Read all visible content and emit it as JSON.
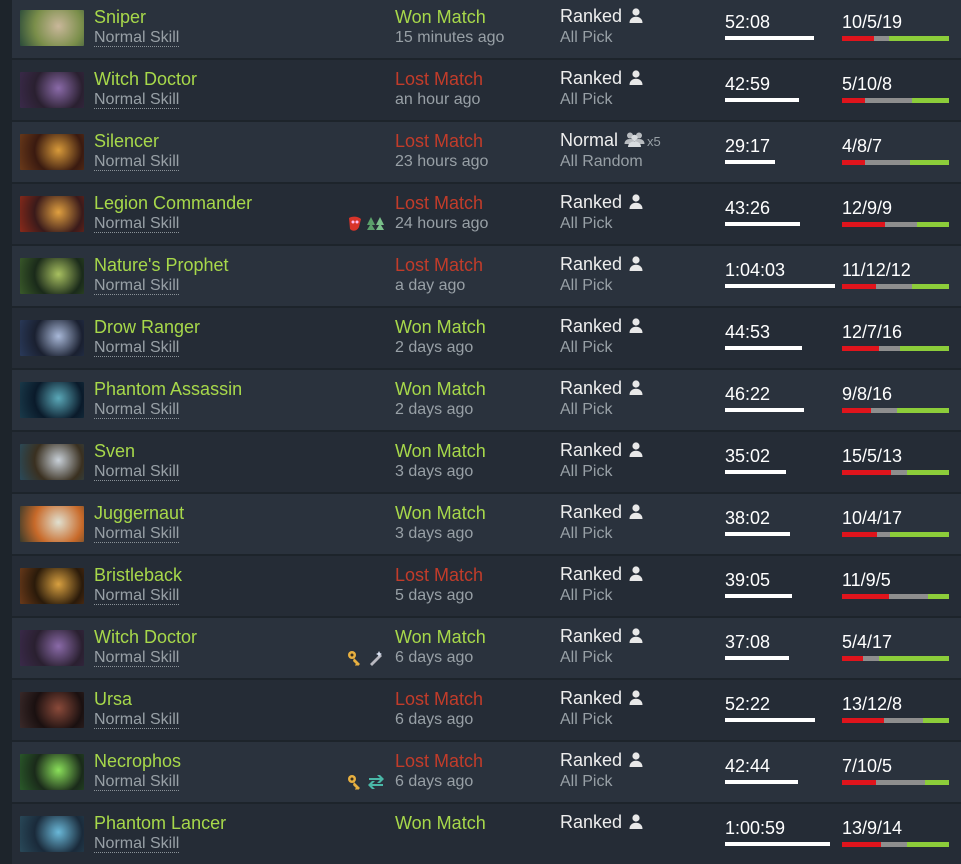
{
  "colors": {
    "won": "#a7d84a",
    "lost": "#c23c2a",
    "kills": "#e0141c",
    "deaths": "#8e8e8e",
    "assists": "#8ccd3a"
  },
  "matches": [
    {
      "hero": "Sniper",
      "skill": "Normal Skill",
      "result": "Won Match",
      "outcome": "won",
      "time_ago": "15 minutes ago",
      "lobby": "Ranked",
      "party": "solo",
      "mode": "All Pick",
      "duration": "52:08",
      "duration_fraction": 0.81,
      "kda": "10/5/19",
      "k": 10,
      "d": 5,
      "a": 19,
      "portrait": [
        "#2a4a3a",
        "#c9b79a",
        "#7a8e4a"
      ],
      "items": []
    },
    {
      "hero": "Witch Doctor",
      "skill": "Normal Skill",
      "result": "Lost Match",
      "outcome": "lost",
      "time_ago": "an hour ago",
      "lobby": "Ranked",
      "party": "solo",
      "mode": "All Pick",
      "duration": "42:59",
      "duration_fraction": 0.67,
      "kda": "5/10/8",
      "k": 5,
      "d": 10,
      "a": 8,
      "portrait": [
        "#3a2a4a",
        "#8a6aa8",
        "#2a2030"
      ],
      "items": []
    },
    {
      "hero": "Silencer",
      "skill": "Normal Skill",
      "result": "Lost Match",
      "outcome": "lost",
      "time_ago": "23 hours ago",
      "lobby": "Normal",
      "party": "x5",
      "party_label": "x5",
      "mode": "All Random",
      "duration": "29:17",
      "duration_fraction": 0.45,
      "kda": "4/8/7",
      "k": 4,
      "d": 8,
      "a": 7,
      "portrait": [
        "#6a3a1a",
        "#d89a3a",
        "#3a1a10"
      ],
      "items": []
    },
    {
      "hero": "Legion Commander",
      "skill": "Normal Skill",
      "result": "Lost Match",
      "outcome": "lost",
      "time_ago": "24 hours ago",
      "lobby": "Ranked",
      "party": "solo",
      "mode": "All Pick",
      "duration": "43:26",
      "duration_fraction": 0.68,
      "kda": "12/9/9",
      "k": 12,
      "d": 9,
      "a": 9,
      "portrait": [
        "#8a2a1a",
        "#e0a040",
        "#3a1a1a"
      ],
      "items": [
        "mask-icon",
        "trees-icon"
      ]
    },
    {
      "hero": "Nature's Prophet",
      "skill": "Normal Skill",
      "result": "Lost Match",
      "outcome": "lost",
      "time_ago": "a day ago",
      "lobby": "Ranked",
      "party": "solo",
      "mode": "All Pick",
      "duration": "1:04:03",
      "duration_fraction": 1.0,
      "kda": "11/12/12",
      "k": 11,
      "d": 12,
      "a": 12,
      "portrait": [
        "#3a5a2a",
        "#a8c060",
        "#1a2a1a"
      ],
      "items": []
    },
    {
      "hero": "Drow Ranger",
      "skill": "Normal Skill",
      "result": "Won Match",
      "outcome": "won",
      "time_ago": "2 days ago",
      "lobby": "Ranked",
      "party": "solo",
      "mode": "All Pick",
      "duration": "44:53",
      "duration_fraction": 0.7,
      "kda": "12/7/16",
      "k": 12,
      "d": 7,
      "a": 16,
      "portrait": [
        "#2a3a5a",
        "#a8b8d8",
        "#1a2030"
      ],
      "items": []
    },
    {
      "hero": "Phantom Assassin",
      "skill": "Normal Skill",
      "result": "Won Match",
      "outcome": "won",
      "time_ago": "2 days ago",
      "lobby": "Ranked",
      "party": "solo",
      "mode": "All Pick",
      "duration": "46:22",
      "duration_fraction": 0.72,
      "kda": "9/8/16",
      "k": 9,
      "d": 8,
      "a": 16,
      "portrait": [
        "#1a3a4a",
        "#5aa8b8",
        "#0a1a2a"
      ],
      "items": []
    },
    {
      "hero": "Sven",
      "skill": "Normal Skill",
      "result": "Won Match",
      "outcome": "won",
      "time_ago": "3 days ago",
      "lobby": "Ranked",
      "party": "solo",
      "mode": "All Pick",
      "duration": "35:02",
      "duration_fraction": 0.55,
      "kda": "15/5/13",
      "k": 15,
      "d": 5,
      "a": 13,
      "portrait": [
        "#2a4a5a",
        "#c8d0d8",
        "#3a3020"
      ],
      "items": []
    },
    {
      "hero": "Juggernaut",
      "skill": "Normal Skill",
      "result": "Won Match",
      "outcome": "won",
      "time_ago": "3 days ago",
      "lobby": "Ranked",
      "party": "solo",
      "mode": "All Pick",
      "duration": "38:02",
      "duration_fraction": 0.59,
      "kda": "10/4/17",
      "k": 10,
      "d": 4,
      "a": 17,
      "portrait": [
        "#3a3a2a",
        "#e0e0d0",
        "#c86a2a"
      ],
      "items": []
    },
    {
      "hero": "Bristleback",
      "skill": "Normal Skill",
      "result": "Lost Match",
      "outcome": "lost",
      "time_ago": "5 days ago",
      "lobby": "Ranked",
      "party": "solo",
      "mode": "All Pick",
      "duration": "39:05",
      "duration_fraction": 0.61,
      "kda": "11/9/5",
      "k": 11,
      "d": 9,
      "a": 5,
      "portrait": [
        "#6a3a1a",
        "#d8a040",
        "#2a1a0a"
      ],
      "items": []
    },
    {
      "hero": "Witch Doctor",
      "skill": "Normal Skill",
      "result": "Won Match",
      "outcome": "won",
      "time_ago": "6 days ago",
      "lobby": "Ranked",
      "party": "solo",
      "mode": "All Pick",
      "duration": "37:08",
      "duration_fraction": 0.58,
      "kda": "5/4/17",
      "k": 5,
      "d": 4,
      "a": 17,
      "portrait": [
        "#3a2a4a",
        "#8a6aa8",
        "#2a2030"
      ],
      "items": [
        "key-icon",
        "wand-icon"
      ]
    },
    {
      "hero": "Ursa",
      "skill": "Normal Skill",
      "result": "Lost Match",
      "outcome": "lost",
      "time_ago": "6 days ago",
      "lobby": "Ranked",
      "party": "solo",
      "mode": "All Pick",
      "duration": "52:22",
      "duration_fraction": 0.82,
      "kda": "13/12/8",
      "k": 13,
      "d": 12,
      "a": 8,
      "portrait": [
        "#3a2a2a",
        "#8a4a3a",
        "#1a1010"
      ],
      "items": []
    },
    {
      "hero": "Necrophos",
      "skill": "Normal Skill",
      "result": "Lost Match",
      "outcome": "lost",
      "time_ago": "6 days ago",
      "lobby": "Ranked",
      "party": "solo",
      "mode": "All Pick",
      "duration": "42:44",
      "duration_fraction": 0.66,
      "kda": "7/10/5",
      "k": 7,
      "d": 10,
      "a": 5,
      "portrait": [
        "#2a5a2a",
        "#8ae05a",
        "#1a2a1a"
      ],
      "items": [
        "key-icon",
        "swap-icon"
      ]
    },
    {
      "hero": "Phantom Lancer",
      "skill": "Normal Skill",
      "result": "Won Match",
      "outcome": "won",
      "time_ago": "",
      "lobby": "Ranked",
      "party": "solo",
      "mode": "",
      "duration": "1:00:59",
      "duration_fraction": 0.95,
      "kda": "13/9/14",
      "k": 13,
      "d": 9,
      "a": 14,
      "portrait": [
        "#2a4a5a",
        "#6ab8d8",
        "#1a2a3a"
      ],
      "items": []
    }
  ]
}
